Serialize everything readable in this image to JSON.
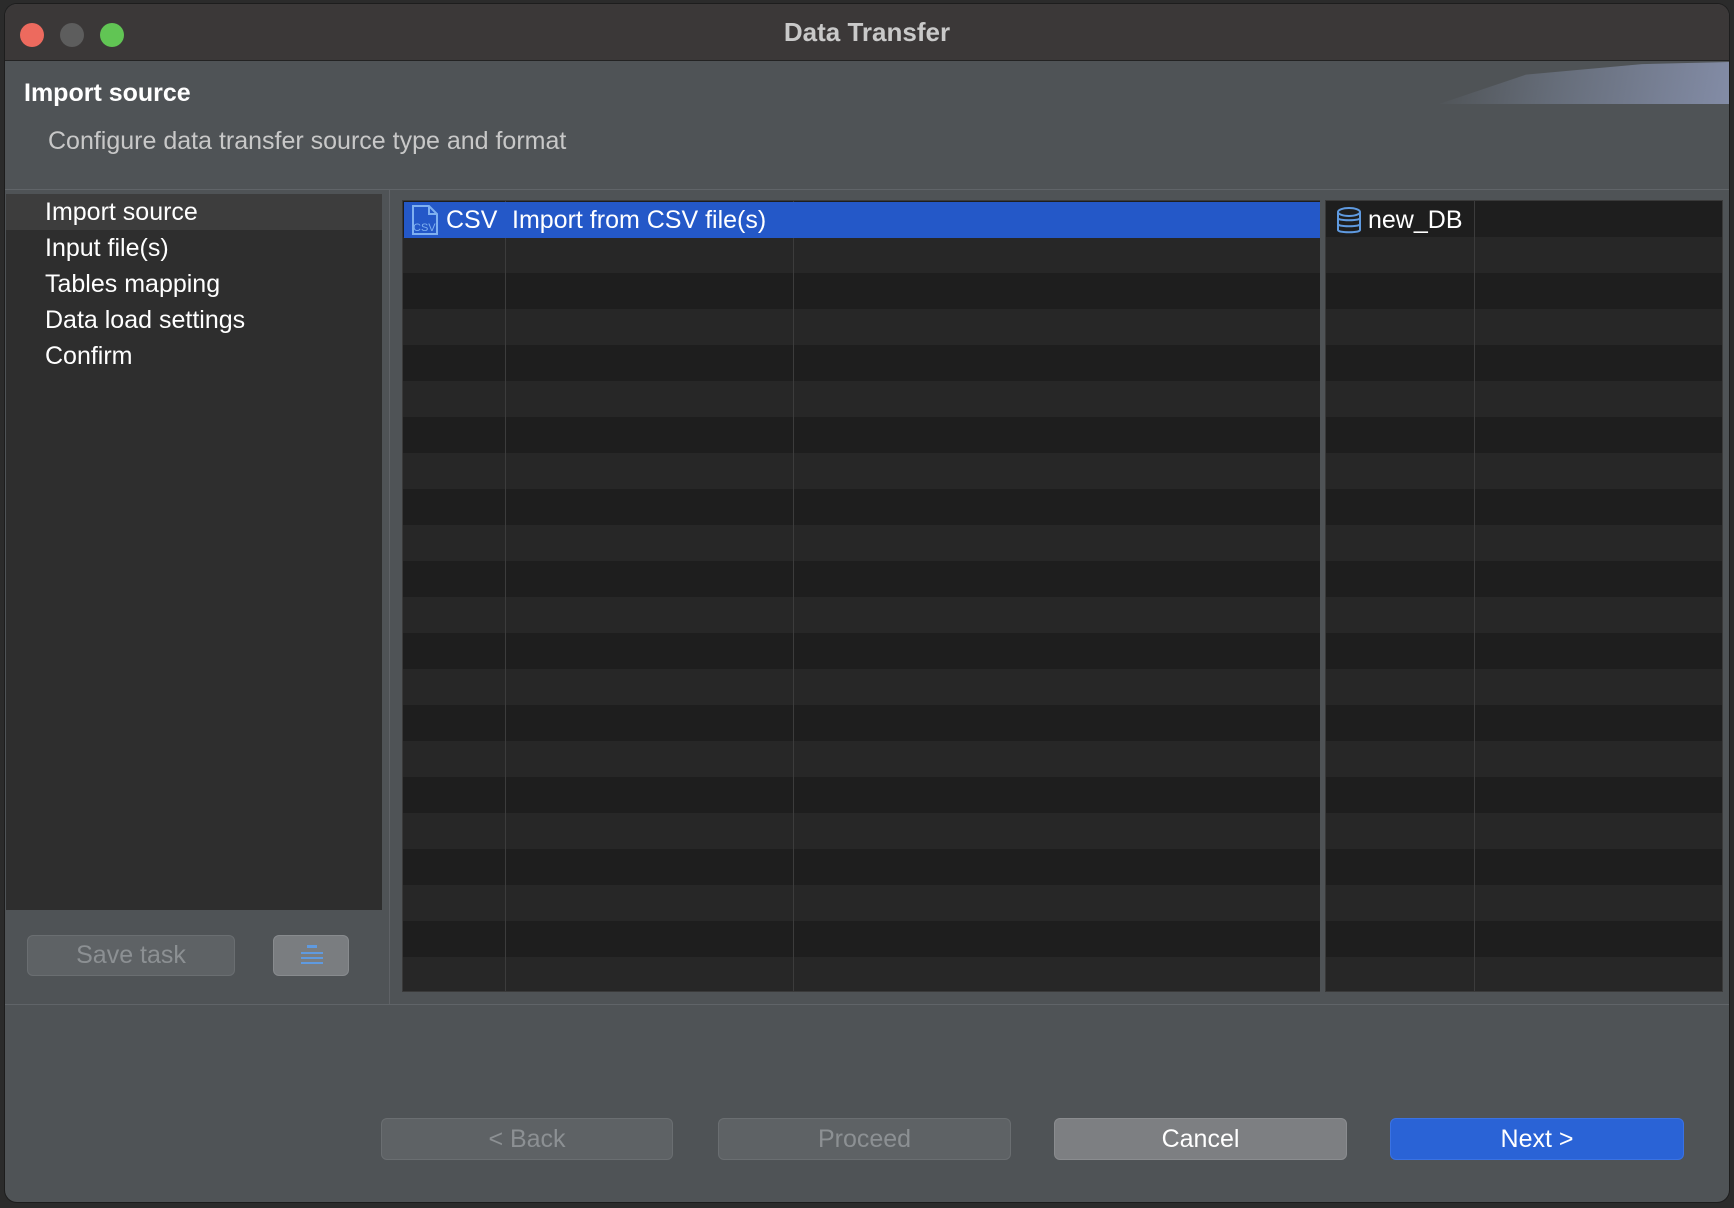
{
  "window": {
    "title": "Data Transfer"
  },
  "header": {
    "title": "Import source",
    "subtitle": "Configure data transfer source type and format"
  },
  "sidebar": {
    "items": [
      {
        "label": "Import source",
        "active": true
      },
      {
        "label": "Input file(s)",
        "active": false
      },
      {
        "label": "Tables mapping",
        "active": false
      },
      {
        "label": "Data load settings",
        "active": false
      },
      {
        "label": "Confirm",
        "active": false
      }
    ],
    "save_task_label": "Save task",
    "task_icon": "task-list-icon"
  },
  "source_table": {
    "rows": [
      {
        "icon": "csv-file-icon",
        "name": "CSV",
        "description": "Import from CSV file(s)",
        "selected": true
      }
    ]
  },
  "target_table": {
    "rows": [
      {
        "icon": "database-icon",
        "name": "new_DB"
      }
    ]
  },
  "footer": {
    "back_label": "< Back",
    "proceed_label": "Proceed",
    "cancel_label": "Cancel",
    "next_label": "Next >"
  },
  "colors": {
    "accent": "#2458c8",
    "primary_button": "#2a63d6",
    "background": "#4f5356",
    "panel": "#1e1e1e"
  }
}
